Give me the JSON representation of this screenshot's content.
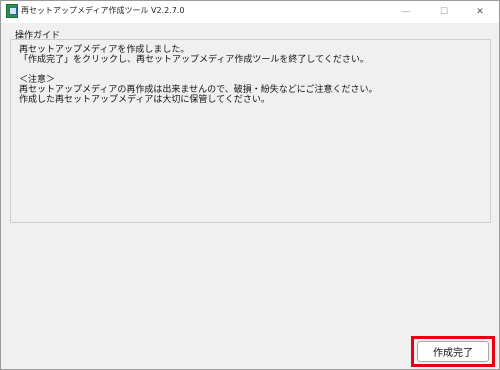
{
  "window": {
    "title": "再セットアップメディア作成ツール V2.2.7.0",
    "controls": {
      "minimize": "—",
      "maximize": "☐",
      "close": "✕"
    }
  },
  "guide": {
    "label": "操作ガイド",
    "lines": [
      "再セットアップメディアを作成しました。",
      "「作成完了」をクリックし、再セットアップメディア作成ツールを終了してください。",
      "",
      "＜注意＞",
      "再セットアップメディアの再作成は出来ませんので、破損・紛失などにご注意ください。",
      "作成した再セットアップメディアは大切に保管してください。"
    ]
  },
  "actions": {
    "finish_label": "作成完了"
  },
  "colors": {
    "highlight": "#e60012"
  }
}
